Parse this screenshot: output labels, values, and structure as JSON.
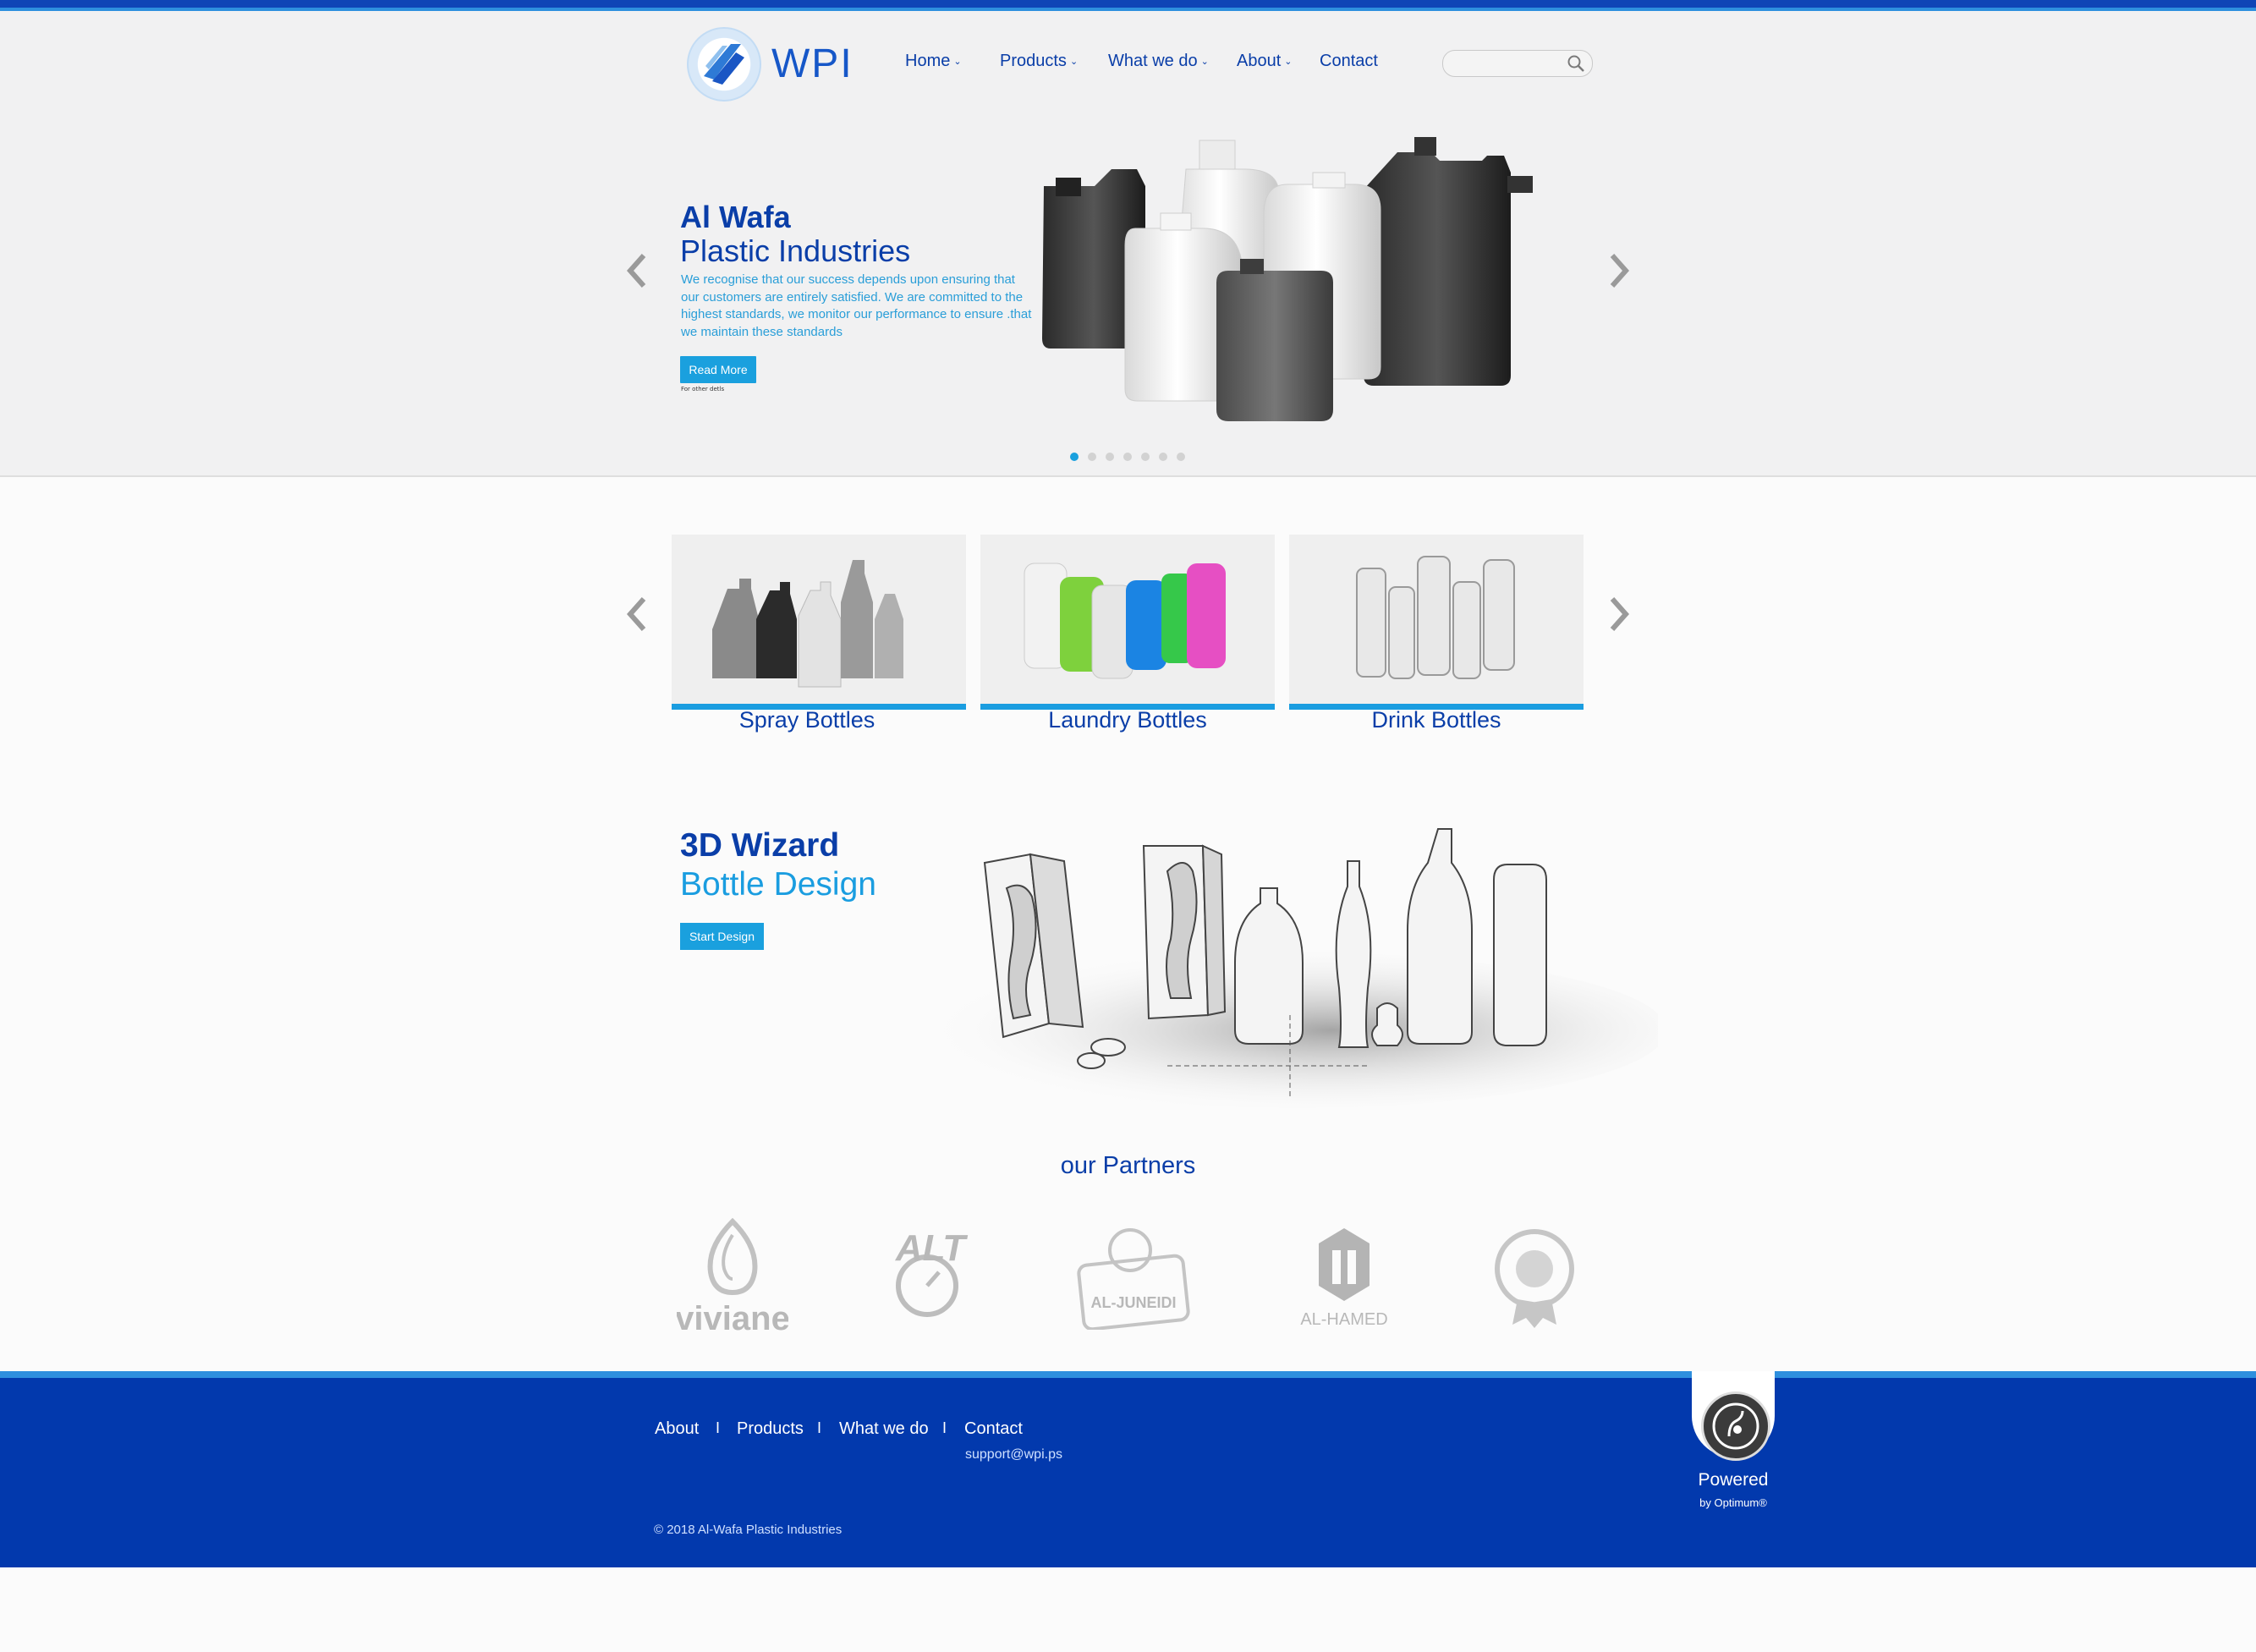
{
  "brand": {
    "logo_text": "WPI",
    "accent": "#1aa0de",
    "primary": "#0239ad"
  },
  "nav": {
    "items": [
      {
        "label": "Home",
        "has_dropdown": true
      },
      {
        "label": "Products",
        "has_dropdown": true
      },
      {
        "label": "What we do",
        "has_dropdown": true
      },
      {
        "label": "About",
        "has_dropdown": true
      },
      {
        "label": "Contact",
        "has_dropdown": false
      }
    ],
    "search": {
      "placeholder": "",
      "icon": "search-icon"
    }
  },
  "hero": {
    "title_line1": "Al Wafa",
    "title_line2": "Plastic Industries",
    "description": "We recognise that our success depends upon ensuring that our customers are entirely satisfied. We are committed to the highest standards, we monitor our performance to ensure .that we maintain these standards",
    "button": "Read More",
    "note": "For other detls",
    "slide_count": 7,
    "active_slide": 1
  },
  "categories": [
    {
      "label": "Spray Bottles"
    },
    {
      "label": "Laundry Bottles"
    },
    {
      "label": "Drink Bottles"
    }
  ],
  "wizard": {
    "title_line1": "3D Wizard",
    "title_line2": "Bottle Design",
    "button": "Start Design"
  },
  "partners": {
    "title": "our Partners",
    "items": [
      {
        "name": "viviane"
      },
      {
        "name": "ALT"
      },
      {
        "name": "AL-JUNEIDI"
      },
      {
        "name": "AL-HAMED"
      },
      {
        "name": "AL-JUNEIDI seal"
      }
    ]
  },
  "footer": {
    "links": [
      "About",
      "Products",
      "What we do",
      "Contact"
    ],
    "separator": "I",
    "email": "support@wpi.ps",
    "copyright": "© 2018 Al-Wafa Plastic Industries",
    "powered_label": "Powered",
    "powered_by": "by Optimum®"
  }
}
